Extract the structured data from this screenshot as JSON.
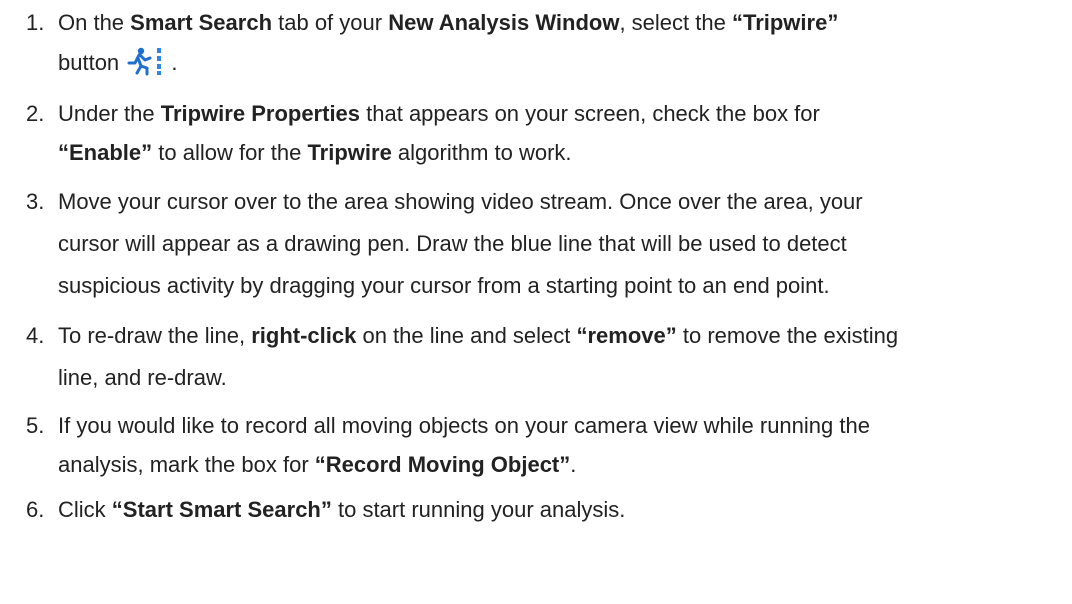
{
  "steps": [
    {
      "number": "1.",
      "line1": {
        "t1": "On the ",
        "b1": "Smart Search",
        "t2": " tab of your ",
        "b2": "New Analysis Window",
        "t3": ", select the ",
        "b3": "“Tripwire”"
      },
      "line2": {
        "t1": "button ",
        "t2": " ."
      },
      "icon": "tripwire-running-person-icon"
    },
    {
      "number": "2.",
      "line1": {
        "t1": "Under the ",
        "b1": "Tripwire Properties",
        "t2": " that appears on your screen, check the box for"
      },
      "line2": {
        "b1": "“Enable”",
        "t1": " to allow for the ",
        "b2": "Tripwire",
        "t2": " algorithm to work."
      }
    },
    {
      "number": "3.",
      "line1": "Move your cursor over to the area showing video stream. Once over the area, your",
      "line2": "cursor will appear as a drawing pen. Draw the blue line that will be used to detect",
      "line3": "suspicious activity by dragging your cursor from a starting point to an end point."
    },
    {
      "number": "4.",
      "line1": {
        "t1": "To re-draw the line, ",
        "b1": "right-click",
        "t2": " on the line and select ",
        "b2": "“remove”",
        "t3": " to remove the existing"
      },
      "line2": "line, and re-draw."
    },
    {
      "number": "5.",
      "line1": "If you would like to record all moving objects on your camera view while running the",
      "line2": {
        "t1": "analysis, mark the box for ",
        "b1": "“Record Moving Object”",
        "t2": "."
      }
    },
    {
      "number": "6.",
      "line1": {
        "t1": "Click ",
        "b1": "“Start Smart Search”",
        "t2": " to start running your analysis."
      }
    }
  ],
  "colors": {
    "text": "#222222",
    "icon_blue": "#1e6fd0",
    "icon_accent": "#2f86e8"
  }
}
